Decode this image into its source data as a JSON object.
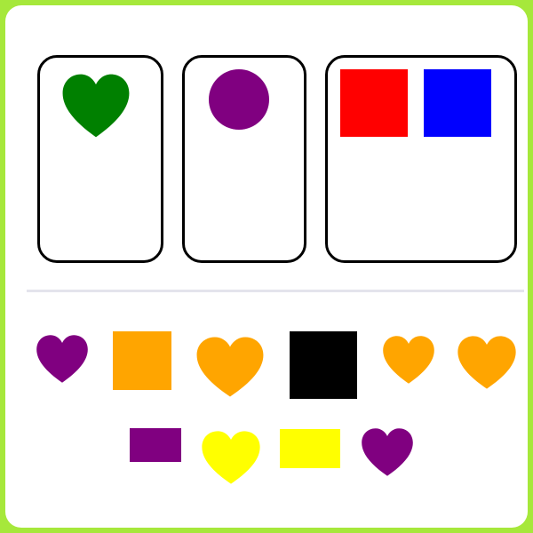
{
  "colors": {
    "frame": "#a6e83b",
    "panel": "#ffffff",
    "divider": "#e4e4ec"
  },
  "bins": [
    {
      "items": [
        {
          "shape": "heart",
          "color": "#008000"
        }
      ]
    },
    {
      "items": [
        {
          "shape": "circle",
          "color": "#800080"
        }
      ]
    },
    {
      "items": [
        {
          "shape": "square",
          "color": "#ff0000"
        },
        {
          "shape": "square",
          "color": "#0000ff"
        }
      ]
    }
  ],
  "pool": [
    {
      "shape": "heart",
      "color": "#800080"
    },
    {
      "shape": "square",
      "color": "#ffa500"
    },
    {
      "shape": "heart",
      "color": "#ffa500"
    },
    {
      "shape": "square",
      "color": "#000000"
    },
    {
      "shape": "heart",
      "color": "#ffa500"
    },
    {
      "shape": "heart",
      "color": "#ffa500"
    },
    {
      "shape": "rectangle",
      "color": "#800080"
    },
    {
      "shape": "heart",
      "color": "#ffff00"
    },
    {
      "shape": "rectangle",
      "color": "#ffff00"
    },
    {
      "shape": "heart",
      "color": "#800080"
    }
  ]
}
